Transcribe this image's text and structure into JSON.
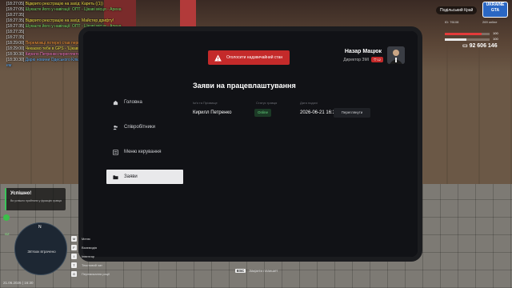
{
  "chat": [
    {
      "time": "[18:27:05]",
      "text": "Вiдкрито реєстрацiю на захiд: Кареть ((1))",
      "color": "yellow"
    },
    {
      "time": "[18:27:05]",
      "text": "Шукаєте його у навiгацiї: ОПТ - Цiкавi мiсця - Арена",
      "color": "green"
    },
    {
      "time": "[18:27:35]",
      "text": "",
      "color": "white"
    },
    {
      "time": "[18:27:35]",
      "text": "Вiдкрито реєстрацiю на захiд: Майстер дрифту!",
      "color": "yellow"
    },
    {
      "time": "[18:27:35]",
      "text": "Шукаєте його у навiгацiї: ОПТ - Цiкавi мiсця - Арена",
      "color": "green"
    },
    {
      "time": "[18:27:35]",
      "text": "",
      "color": "white"
    },
    {
      "time": "[18:27:35]",
      "text": "",
      "color": "white"
    },
    {
      "time": "[18:29:00]",
      "text": "Переможцi лотереї став першою лотереї i виграв ЗМI",
      "color": "orange"
    },
    {
      "time": "[18:29:00]",
      "text": "Чекаємо тебе в GPS - 'Цiкавi мiсця' -> 'Казино'.",
      "color": "yellow"
    },
    {
      "time": "[18:30:30]",
      "text": "Кирило Петренко переглянте заяву до ЗМI",
      "color": "pink"
    },
    {
      "time": "[18:30:30]",
      "text": "Дарю новини Одеського Клієнтiвського. Оголосiть провайдери Подiльського К",
      "color": "blue"
    },
    {
      "time": "",
      "text": "ем",
      "color": "blue"
    }
  ],
  "hud": {
    "region": "Подільський Край",
    "logo": "UKRAINE GTA",
    "id": "ID: 76108",
    "online": "269 online",
    "hp_value": "100",
    "hp_fraction": 0.82,
    "armor_value": "100",
    "armor_fraction": 0.48,
    "money": "92 606 146"
  },
  "tablet": {
    "alert_button": "Оголосити надзвичайний стан",
    "user_name": "Назар Мацюк",
    "user_role": "Директор ЗМІ",
    "user_badge": "12",
    "sidebar": [
      {
        "label": "Головна",
        "icon": "home-icon",
        "active": false
      },
      {
        "label": "Співробітники",
        "icon": "users-icon",
        "active": false
      },
      {
        "label": "Меню керування",
        "icon": "settings-icon",
        "active": false
      },
      {
        "label": "Заяви",
        "icon": "folder-icon",
        "active": true
      }
    ],
    "page_title": "Заяви на працевлаштування",
    "table": {
      "headers": [
        "Ім'я та Прізвище",
        "Статус гравця",
        "Дата подачі"
      ],
      "rows": [
        {
          "name": "Кирилл Петренко",
          "status": "Online",
          "date": "2026-06-21 16:30:07",
          "action": "Переглянути"
        }
      ]
    }
  },
  "notification": {
    "title": "Успішно!",
    "text": "Ви успішно прийняли у фракцію гравця"
  },
  "minimap": {
    "label": "Зв'язок втрачено",
    "compass": "N",
    "gz": "GZ"
  },
  "keys": [
    {
      "key": "M",
      "label": "Меню"
    },
    {
      "key": "F",
      "label": "Взаємодія"
    },
    {
      "key": "I",
      "label": "Інвентар"
    },
    {
      "key": "T",
      "label": "Текстовий чат"
    },
    {
      "key": "G",
      "label": "Перемикання рації"
    }
  ],
  "esc_hint": {
    "key": "ESC",
    "label": "Закрити планшет"
  },
  "datetime": "21.06.2026 | 16:30",
  "colors": {
    "accent_red": "#c42a2a",
    "online_green": "#63d27e",
    "tablet_bg": "#111216",
    "hp_bar": "#e33b3b",
    "armor_bar": "#e8e8e8"
  }
}
